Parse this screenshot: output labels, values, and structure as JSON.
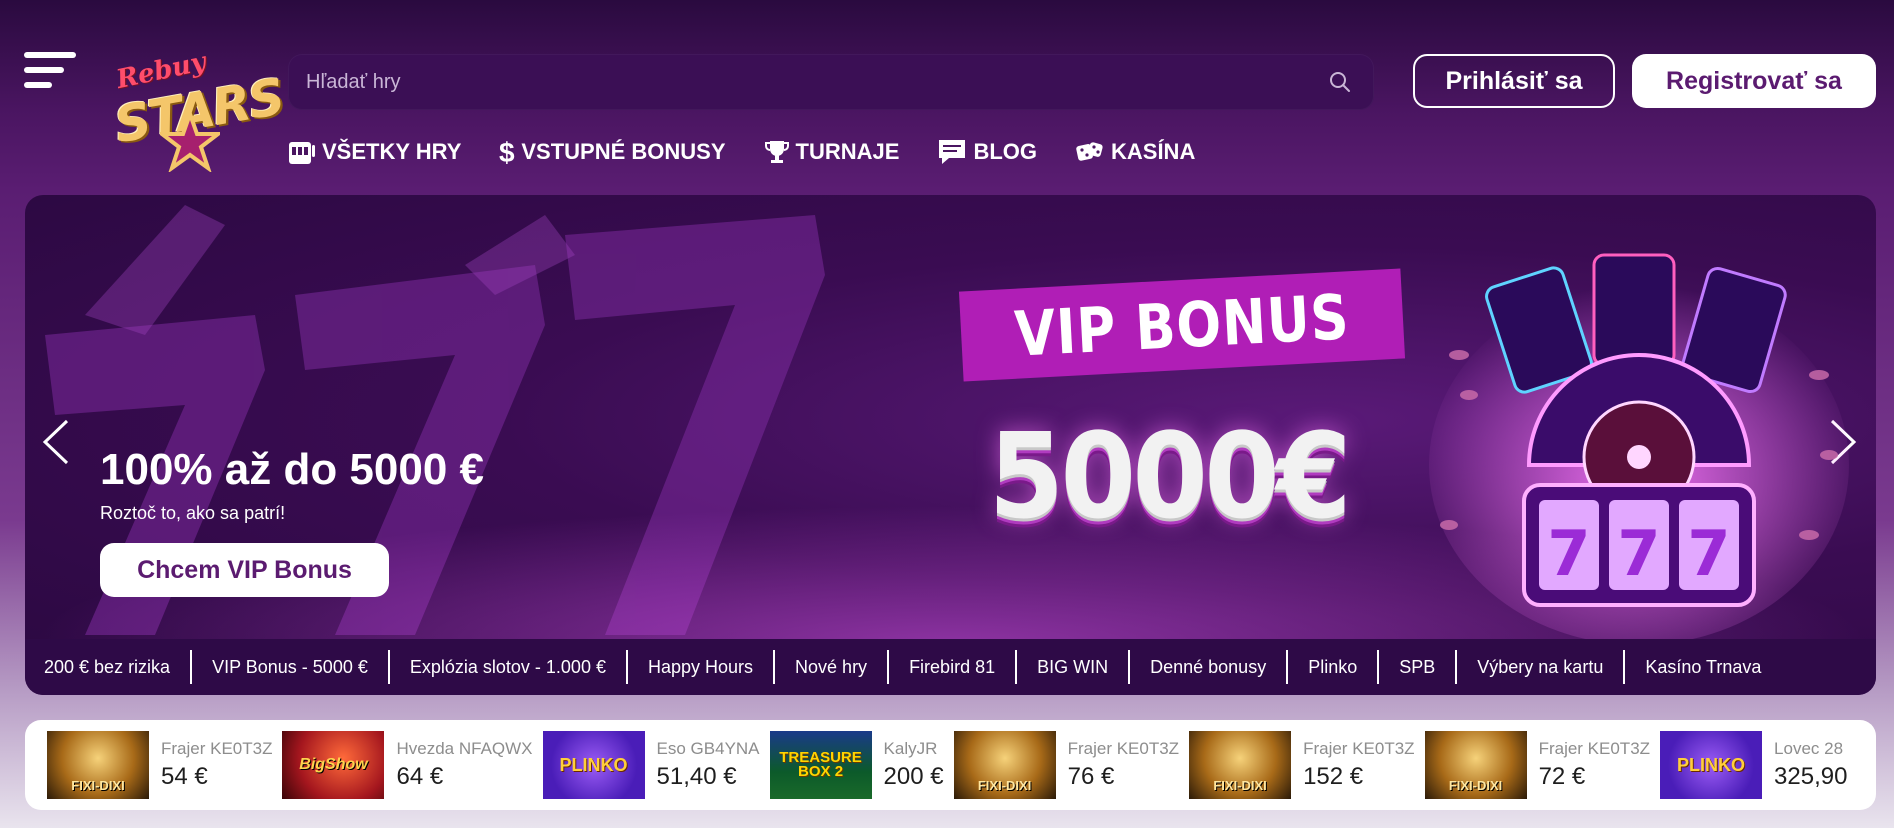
{
  "header": {
    "logo_text_small": "Rebuy",
    "logo_text_big": "STARS",
    "search_placeholder": "Hľadať hry",
    "login_label": "Prihlásiť sa",
    "register_label": "Registrovať sa"
  },
  "nav": [
    {
      "label": "VŠETKY HRY",
      "icon": "slot-machine-icon"
    },
    {
      "label": "VSTUPNÉ BONUSY",
      "icon": "dollar-icon"
    },
    {
      "label": "TURNAJE",
      "icon": "trophy-icon"
    },
    {
      "label": "BLOG",
      "icon": "chat-icon"
    },
    {
      "label": "KASÍNA",
      "icon": "dice-icon"
    }
  ],
  "hero": {
    "title": "100% až do 5000 €",
    "subtitle": "Roztoč to, ako sa patrí!",
    "cta_label": "Chcem VIP Bonus",
    "badge_text": "VIP BONUS",
    "amount_text": "5000€"
  },
  "promo_tabs": [
    "200 € bez rizika",
    "VIP Bonus - 5000 €",
    "Explózia slotov - 1.000 €",
    "Happy Hours",
    "Nové hry",
    "Firebird 81",
    "BIG WIN",
    "Denné bonusy",
    "Plinko",
    "SPB",
    "Výbery na kartu",
    "Kasíno Trnava"
  ],
  "winners": [
    {
      "game": "FIXI-DIXI",
      "name": "Frajer KE0T3Z",
      "amount": "54 €",
      "style": "fixi"
    },
    {
      "game": "BigShow",
      "name": "Hvezda NFAQWX",
      "amount": "64 €",
      "style": "bigshow"
    },
    {
      "game": "PLINKO",
      "name": "Eso GB4YNA",
      "amount": "51,40 €",
      "style": "plinko"
    },
    {
      "game": "TREASURE BOX 2",
      "name": "KalyJR",
      "amount": "200 €",
      "style": "treasure"
    },
    {
      "game": "FIXI-DIXI",
      "name": "Frajer KE0T3Z",
      "amount": "76 €",
      "style": "fixi"
    },
    {
      "game": "FIXI-DIXI",
      "name": "Frajer KE0T3Z",
      "amount": "152 €",
      "style": "fixi"
    },
    {
      "game": "FIXI-DIXI",
      "name": "Frajer KE0T3Z",
      "amount": "72 €",
      "style": "fixi"
    },
    {
      "game": "PLINKO",
      "name": "Lovec 28",
      "amount": "325,90",
      "style": "plinko"
    }
  ]
}
